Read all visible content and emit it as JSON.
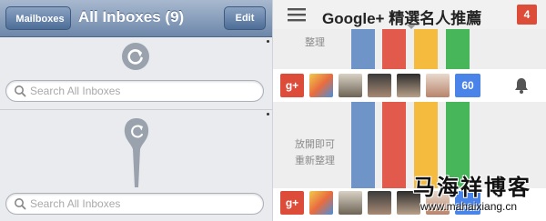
{
  "mail": {
    "back_label": "Mailboxes",
    "title": "All Inboxes (9)",
    "edit_label": "Edit",
    "search_placeholder_top": "Search All Inboxes",
    "search_placeholder_bottom": "Search All Inboxes"
  },
  "gplus": {
    "title": "Google+ 精選名人推薦",
    "notification_count": "4",
    "top_fragment": "整理",
    "logo_text": "g+",
    "more_count": "60",
    "side_text_line1": "放開即可",
    "side_text_line2": "重新整理",
    "bar_colors": [
      "#6f95c8",
      "#e15a4b",
      "#f4bb3f",
      "#47b55a"
    ]
  },
  "watermark": {
    "title": "马海祥博客",
    "url": "www.mahaixiang.cn"
  }
}
